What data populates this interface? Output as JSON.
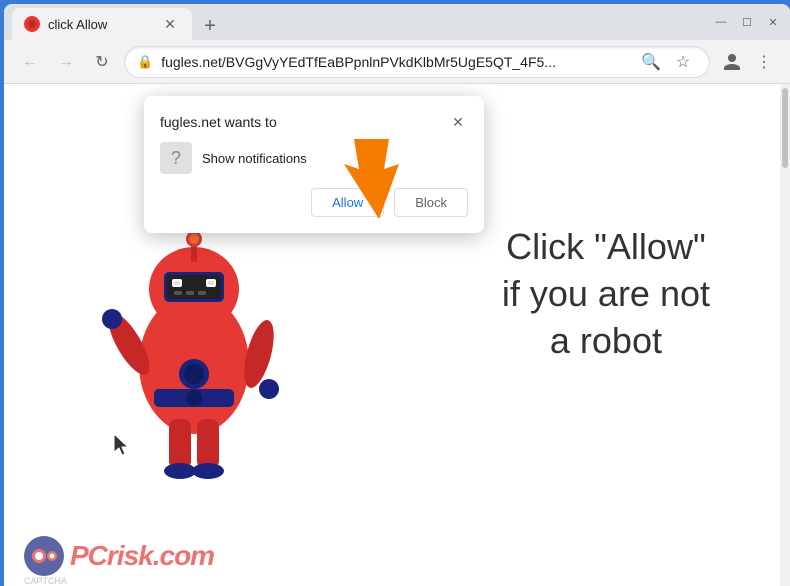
{
  "browser": {
    "tab": {
      "title": "click Allow",
      "favicon": "red-circle"
    },
    "new_tab_label": "+",
    "window_controls": {
      "minimize": "—",
      "maximize": "☐",
      "close": "✕"
    },
    "address_bar": {
      "url": "fugles.net/BVGgVyYEdTfEaBPpnlnPVkdKlbMr5UgE5QT_4F5...",
      "lock_icon": "🔒"
    },
    "nav": {
      "back": "←",
      "forward": "→",
      "refresh": "↻"
    }
  },
  "popup": {
    "title": "fugles.net wants to",
    "notification_label": "Show notifications",
    "allow_label": "Allow",
    "block_label": "Block",
    "close_icon": "✕"
  },
  "page": {
    "click_allow_line1": "Click \"Allow\"",
    "click_allow_line2": "if you are not",
    "click_allow_line3": "a robot"
  },
  "watermark": {
    "logo_text": "CAPTCHA",
    "brand": "risk.com",
    "brand_prefix": "PC"
  },
  "colors": {
    "accent": "#1a73e8",
    "robot_red": "#e53935",
    "arrow_orange": "#f57c00",
    "brand_red": "#e53935"
  }
}
